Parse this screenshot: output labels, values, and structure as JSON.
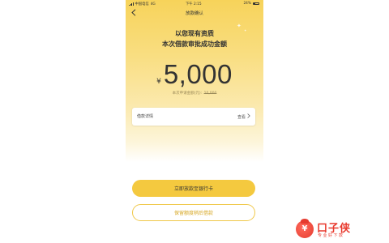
{
  "status_bar": {
    "carrier": "中国电信",
    "network": "4G",
    "time": "下午 2:15",
    "battery": "24%"
  },
  "nav": {
    "title": "放款确认",
    "back_icon": "chevron-left-icon"
  },
  "headline": {
    "line1": "以您现有资质",
    "line2": "本次借款审批成功金额"
  },
  "amount": {
    "currency": "¥",
    "value": "5,000"
  },
  "applied": {
    "label": "本次申请金额(元):",
    "value": "10,000"
  },
  "detail_card": {
    "label": "借款详情",
    "action": "查看",
    "action_icon": "chevron-right-icon"
  },
  "buttons": {
    "primary": "立即放款至银行卡",
    "secondary": "保留额度稍后借款"
  },
  "watermark": {
    "title": "口子侠",
    "subtitle": "专业好下款",
    "logo_symbol": "¥"
  },
  "colors": {
    "primary_yellow": "#f4c93f",
    "accent_gold": "#d7a928",
    "watermark_red": "#e8392d"
  }
}
